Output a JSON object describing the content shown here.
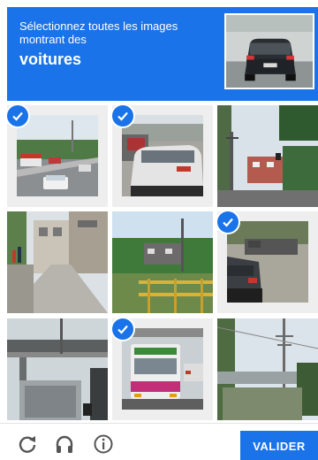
{
  "header": {
    "instruction_line1": "Sélectionnez toutes les images",
    "instruction_line2": "montrant des",
    "target_object": "voitures"
  },
  "grid": {
    "columns": 3,
    "rows": 3,
    "tiles": [
      {
        "row": 0,
        "col": 0,
        "selected": true
      },
      {
        "row": 0,
        "col": 1,
        "selected": true
      },
      {
        "row": 0,
        "col": 2,
        "selected": false
      },
      {
        "row": 1,
        "col": 0,
        "selected": false
      },
      {
        "row": 1,
        "col": 1,
        "selected": false
      },
      {
        "row": 1,
        "col": 2,
        "selected": true
      },
      {
        "row": 2,
        "col": 0,
        "selected": false
      },
      {
        "row": 2,
        "col": 1,
        "selected": true
      },
      {
        "row": 2,
        "col": 2,
        "selected": false
      }
    ]
  },
  "footer": {
    "icons": [
      "reload-icon",
      "audio-challenge-icon",
      "info-icon"
    ],
    "verify_label": "VALIDER"
  },
  "colors": {
    "accent": "#1a73e8",
    "icon": "#555555"
  }
}
